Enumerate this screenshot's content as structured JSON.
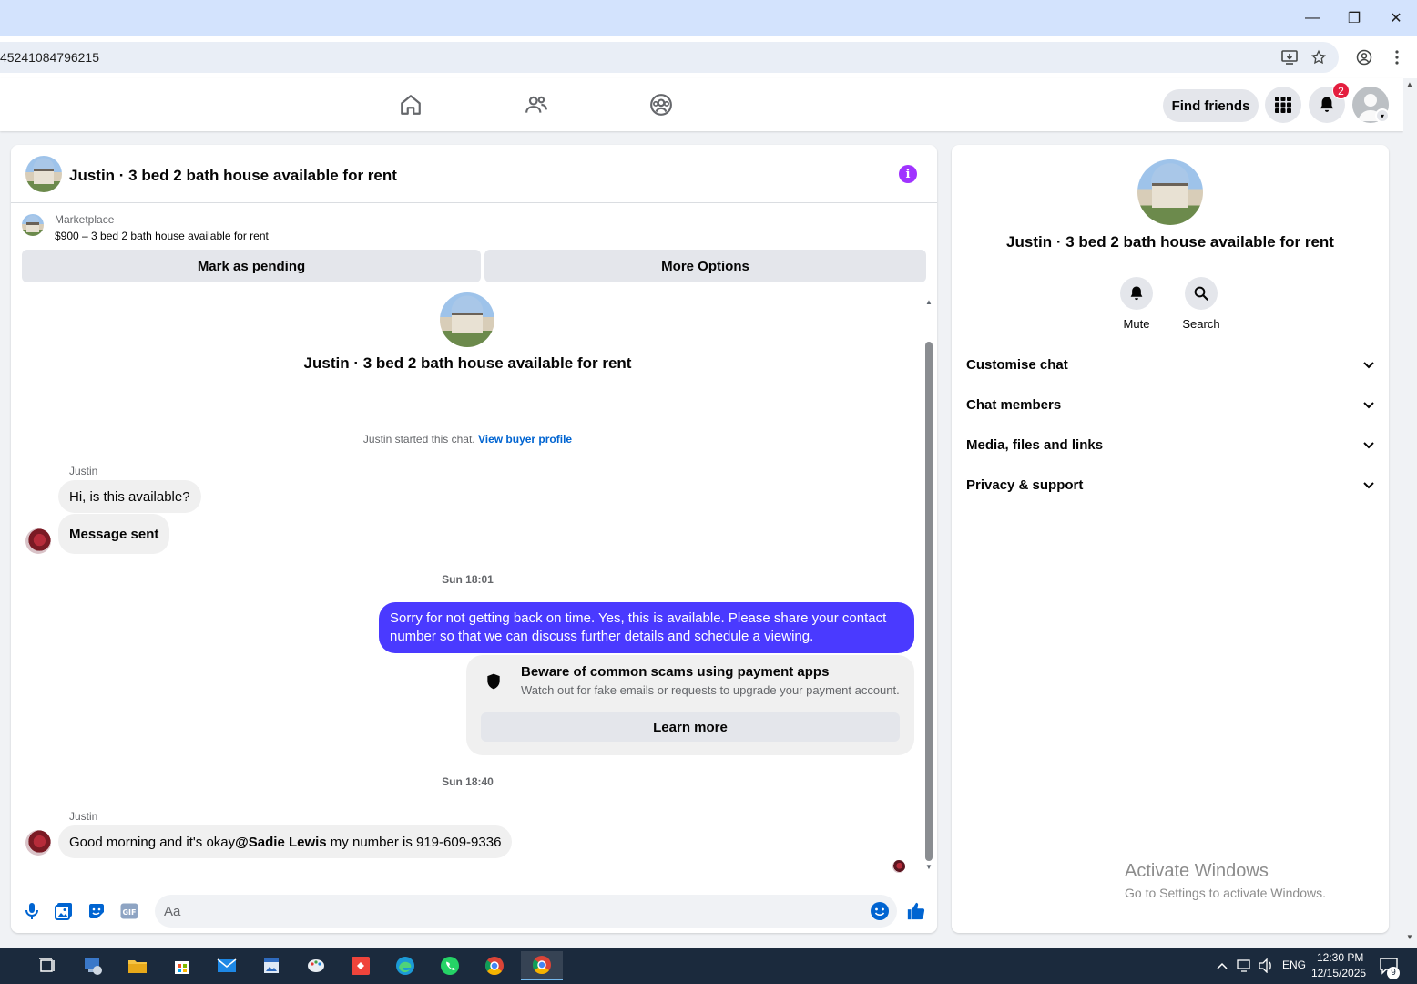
{
  "browser": {
    "url_fragment": "45241084796215",
    "controls": {
      "minimize": "—",
      "restore": "❐",
      "close": "✕"
    }
  },
  "header": {
    "find_friends": "Find friends",
    "notification_count": "2"
  },
  "chat": {
    "title": "Justin · 3 bed 2 bath house available for rent",
    "info_glyph": "i",
    "marketplace_label": "Marketplace",
    "listing": "$900 – 3 bed 2 bath house available for rent",
    "mark_pending": "Mark as pending",
    "more_options": "More Options",
    "intro_title": "Justin · 3 bed 2 bath house available for rent",
    "started_text": "Justin started this chat. ",
    "view_buyer_profile": "View buyer profile",
    "sender1": "Justin",
    "msg1": "Hi, is this available?",
    "msg2": "Message sent",
    "time1": "Sun 18:01",
    "msg_out": "Sorry for not getting back on time. Yes, this is available. Please share your contact number so that we can discuss further details and schedule a viewing.",
    "scam_title": "Beware of common scams using payment apps",
    "scam_desc": "Watch out for fake emails or requests to upgrade your payment account.",
    "learn_more": "Learn more",
    "time2": "Sun 18:40",
    "sender2": "Justin",
    "msg3_pre": "Good morning and it's okay ",
    "msg3_mention": "@Sadie Lewis",
    "msg3_post": " my number is 919-609-9336",
    "composer_placeholder": "Aa"
  },
  "info_panel": {
    "name": "Justin · 3 bed 2 bath house available for rent",
    "mute": "Mute",
    "search": "Search",
    "rows": [
      "Customise chat",
      "Chat members",
      "Media, files and links",
      "Privacy & support"
    ]
  },
  "watermark": {
    "line1": "Activate Windows",
    "line2": "Go to Settings to activate Windows."
  },
  "taskbar": {
    "lang": "ENG",
    "time": "12:30 PM",
    "date": "12/15/2025",
    "notif_count": "9"
  },
  "colors": {
    "accent": "#4a3aff",
    "link": "#0064d1",
    "badge": "#e41e3f",
    "taskbar": "#1b2a3d"
  }
}
